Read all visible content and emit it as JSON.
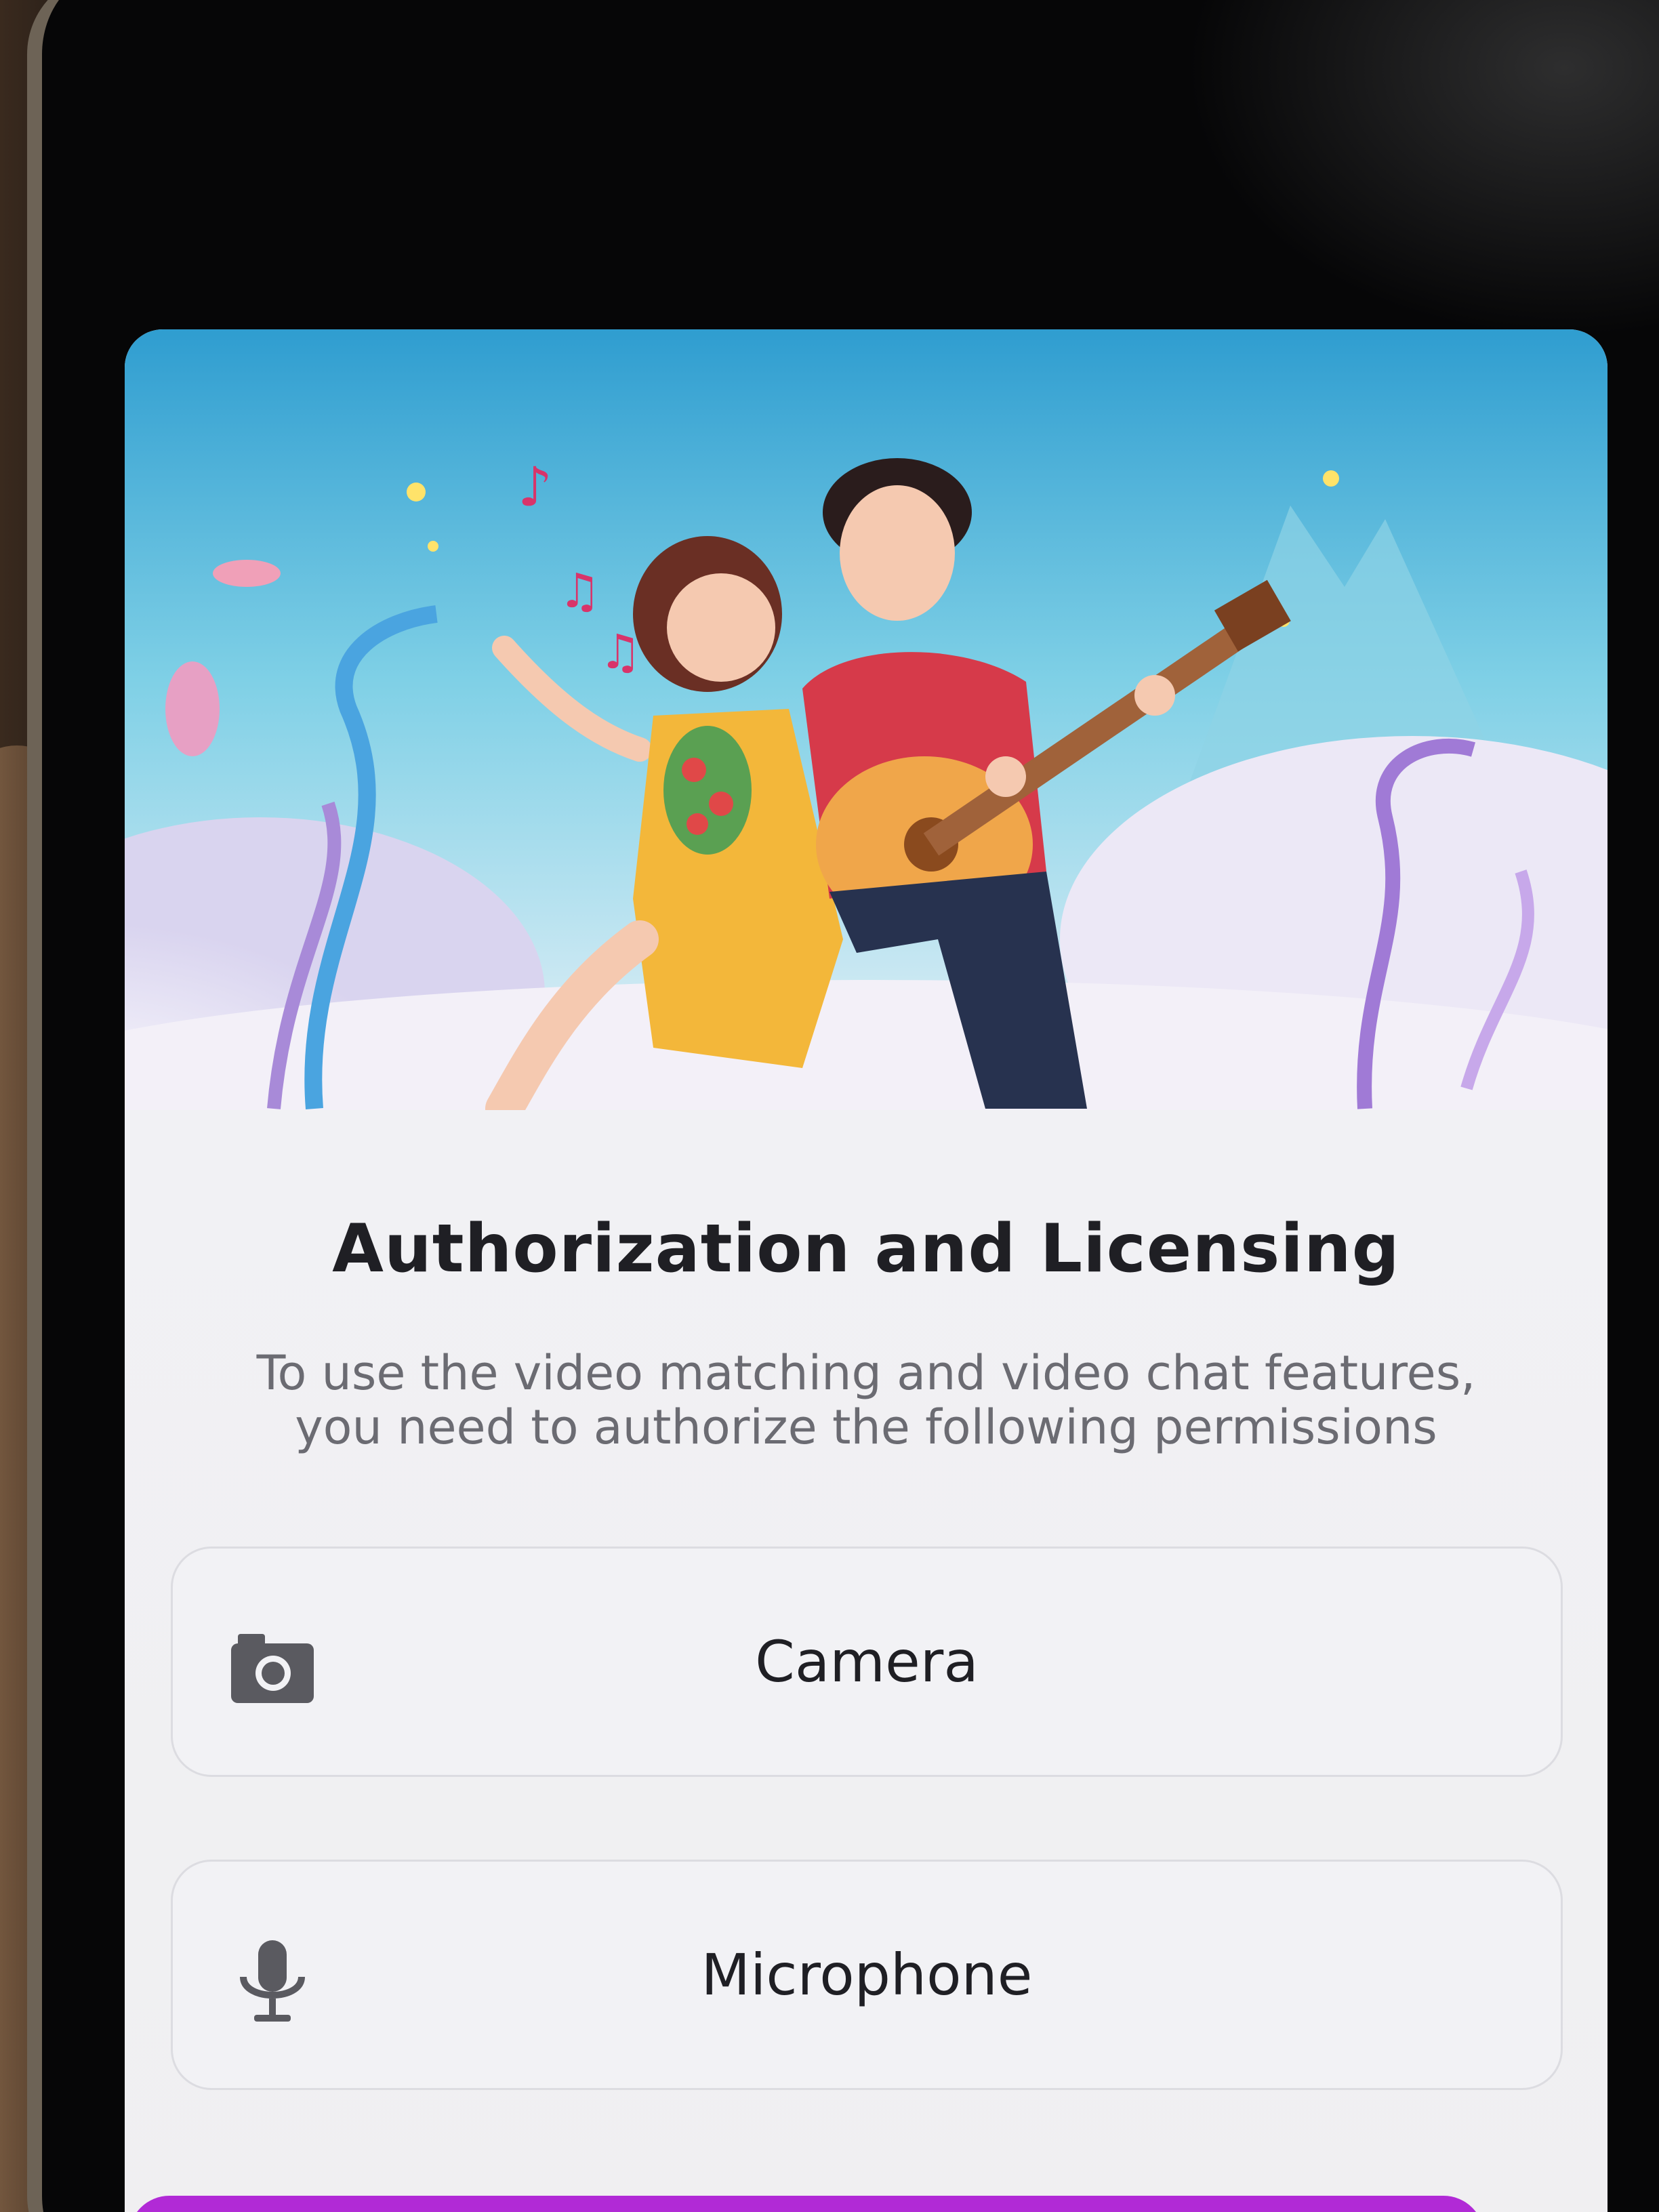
{
  "dialog": {
    "title": "Authorization and Licensing",
    "subtitle_line1": "To use the video matching and video chat features,",
    "subtitle_line2": "you need to authorize the following permissions",
    "permissions": [
      {
        "label": "Camera",
        "icon": "camera-icon"
      },
      {
        "label": "Microphone",
        "icon": "microphone-icon"
      }
    ]
  },
  "colors": {
    "title": "#1f1f24",
    "subtitle": "#6b6b72",
    "row_border": "#dcdce1",
    "icon": "#5a5a60",
    "button_accent": "#b12ad6"
  }
}
